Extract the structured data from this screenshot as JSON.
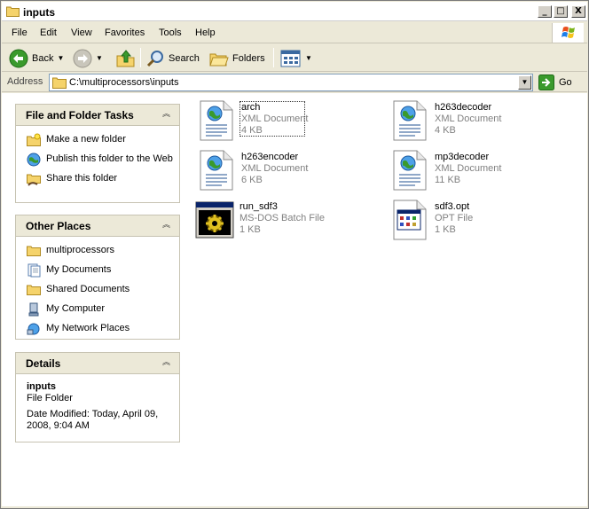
{
  "window": {
    "title": "inputs"
  },
  "titlebar_buttons": {
    "minimize": "_",
    "maximize": "□",
    "close": "X"
  },
  "menu": [
    "File",
    "Edit",
    "View",
    "Favorites",
    "Tools",
    "Help"
  ],
  "toolbar": {
    "back": "Back",
    "search": "Search",
    "folders": "Folders"
  },
  "address": {
    "label": "Address",
    "value": "C:\\multiprocessors\\inputs",
    "go": "Go"
  },
  "tasks": {
    "title": "File and Folder Tasks",
    "items": [
      {
        "label": "Make a new folder",
        "icon": "new-folder-icon"
      },
      {
        "label": "Publish this folder to the Web",
        "icon": "publish-web-icon"
      },
      {
        "label": "Share this folder",
        "icon": "share-folder-icon"
      }
    ]
  },
  "other_places": {
    "title": "Other Places",
    "items": [
      {
        "label": "multiprocessors",
        "icon": "folder-icon"
      },
      {
        "label": "My Documents",
        "icon": "my-documents-icon"
      },
      {
        "label": "Shared Documents",
        "icon": "shared-documents-icon"
      },
      {
        "label": "My Computer",
        "icon": "my-computer-icon"
      },
      {
        "label": "My Network Places",
        "icon": "network-places-icon"
      }
    ]
  },
  "details": {
    "title": "Details",
    "name": "inputs",
    "type": "File Folder",
    "modified": "Date Modified: Today, April 09, 2008, 9:04 AM"
  },
  "files": [
    {
      "name": "arch",
      "type": "XML Document",
      "size": "4 KB",
      "icon": "xml-document-icon"
    },
    {
      "name": "h263decoder",
      "type": "XML Document",
      "size": "4 KB",
      "icon": "xml-document-icon"
    },
    {
      "name": "h263encoder",
      "type": "XML Document",
      "size": "6 KB",
      "icon": "xml-document-icon"
    },
    {
      "name": "mp3decoder",
      "type": "XML Document",
      "size": "11 KB",
      "icon": "xml-document-icon"
    },
    {
      "name": "run_sdf3",
      "type": "MS-DOS Batch File",
      "size": "1 KB",
      "icon": "batch-file-icon"
    },
    {
      "name": "sdf3.opt",
      "type": "OPT File",
      "size": "1 KB",
      "icon": "opt-file-icon"
    }
  ]
}
